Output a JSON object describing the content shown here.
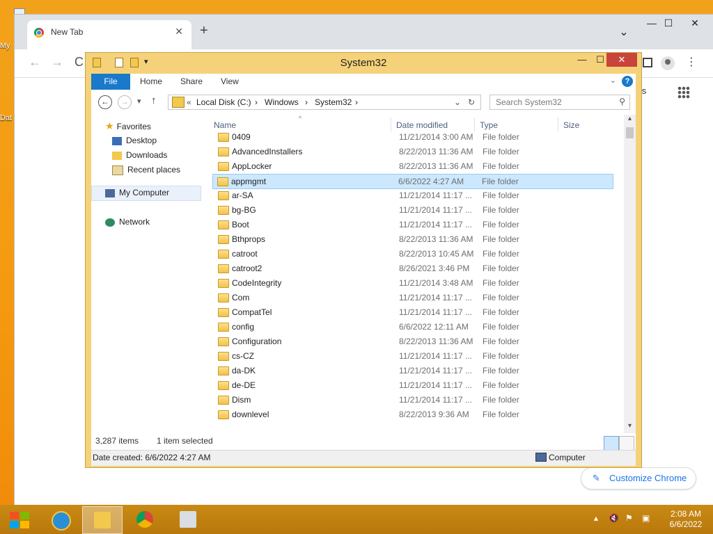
{
  "desktop": {
    "icon1_label": "My",
    "icon2_label": "Dat"
  },
  "chrome": {
    "tab_title": "New Tab",
    "tab_close": "✕",
    "new_tab": "+",
    "tabs_menu": "⌄",
    "min": "—",
    "max": "☐",
    "close": "✕",
    "back": "←",
    "forward": "→",
    "reload": "C",
    "menu": "⋮",
    "images_link": "ages",
    "customize_label": "Customize Chrome",
    "customize_icon": "✎"
  },
  "explorer": {
    "title": "System32",
    "qat_caret": "▾",
    "min": "—",
    "max": "☐",
    "close": "✕",
    "ribbon": {
      "tabs": [
        "File",
        "Home",
        "Share",
        "View"
      ],
      "expand_caret": "⌄",
      "help": "?"
    },
    "nav": {
      "back": "←",
      "forward": "→",
      "dropdown": "▾",
      "up": "↑"
    },
    "address": {
      "chevrons": "«",
      "crumbs": [
        "Local Disk (C:)",
        "Windows",
        "System32"
      ],
      "sep": "›",
      "dropdown": "⌄",
      "refresh": "↻"
    },
    "search": {
      "placeholder": "Search System32",
      "icon": "⚲"
    },
    "navpane": {
      "favorites": "Favorites",
      "desktop": "Desktop",
      "downloads": "Downloads",
      "recent": "Recent places",
      "computer": "My Computer",
      "network": "Network"
    },
    "columns": {
      "name": "Name",
      "date": "Date modified",
      "type": "Type",
      "size": "Size",
      "sort_indicator": "^"
    },
    "files": [
      {
        "name": "0409",
        "date": "11/21/2014 3:00 AM",
        "type": "File folder"
      },
      {
        "name": "AdvancedInstallers",
        "date": "8/22/2013 11:36 AM",
        "type": "File folder"
      },
      {
        "name": "AppLocker",
        "date": "8/22/2013 11:36 AM",
        "type": "File folder"
      },
      {
        "name": "appmgmt",
        "date": "6/6/2022 4:27 AM",
        "type": "File folder",
        "selected": true
      },
      {
        "name": "ar-SA",
        "date": "11/21/2014 11:17 ...",
        "type": "File folder"
      },
      {
        "name": "bg-BG",
        "date": "11/21/2014 11:17 ...",
        "type": "File folder"
      },
      {
        "name": "Boot",
        "date": "11/21/2014 11:17 ...",
        "type": "File folder"
      },
      {
        "name": "Bthprops",
        "date": "8/22/2013 11:36 AM",
        "type": "File folder"
      },
      {
        "name": "catroot",
        "date": "8/22/2013 10:45 AM",
        "type": "File folder"
      },
      {
        "name": "catroot2",
        "date": "8/26/2021 3:46 PM",
        "type": "File folder"
      },
      {
        "name": "CodeIntegrity",
        "date": "11/21/2014 3:48 AM",
        "type": "File folder"
      },
      {
        "name": "Com",
        "date": "11/21/2014 11:17 ...",
        "type": "File folder"
      },
      {
        "name": "CompatTel",
        "date": "11/21/2014 11:17 ...",
        "type": "File folder"
      },
      {
        "name": "config",
        "date": "6/6/2022 12:11 AM",
        "type": "File folder"
      },
      {
        "name": "Configuration",
        "date": "8/22/2013 11:36 AM",
        "type": "File folder"
      },
      {
        "name": "cs-CZ",
        "date": "11/21/2014 11:17 ...",
        "type": "File folder"
      },
      {
        "name": "da-DK",
        "date": "11/21/2014 11:17 ...",
        "type": "File folder"
      },
      {
        "name": "de-DE",
        "date": "11/21/2014 11:17 ...",
        "type": "File folder"
      },
      {
        "name": "Dism",
        "date": "11/21/2014 11:17 ...",
        "type": "File folder"
      },
      {
        "name": "downlevel",
        "date": "8/22/2013 9:36 AM",
        "type": "File folder"
      }
    ],
    "scroll": {
      "up": "▴",
      "down": "▾"
    },
    "status": {
      "item_count": "3,287 items",
      "selected": "1 item selected"
    },
    "details": {
      "date_created": "Date created: 6/6/2022 4:27 AM",
      "location": "Computer"
    }
  },
  "taskbar": {
    "tray_caret": "▴",
    "time": "2:08 AM",
    "date": "6/6/2022"
  },
  "colors": {
    "desktop": "#f39c12",
    "explorer_frame": "#f5d27a",
    "selection": "#cce8ff",
    "accent_blue": "#1979ca",
    "close_red": "#c9443a"
  }
}
